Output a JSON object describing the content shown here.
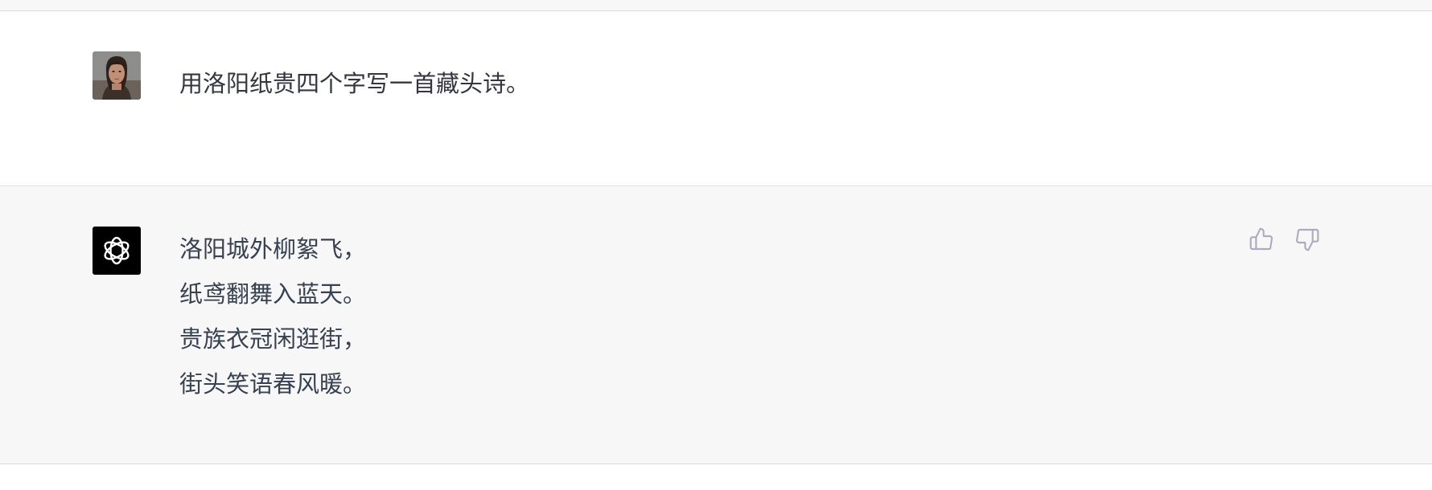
{
  "conversation": {
    "user_message": {
      "avatar_icon": "user-portrait-avatar",
      "text": "用洛阳纸贵四个字写一首藏头诗。"
    },
    "assistant_message": {
      "avatar_icon": "openai-logo-icon",
      "lines": [
        "洛阳城外柳絮飞，",
        "纸鸢翻舞入蓝天。",
        "贵族衣冠闲逛街，",
        "街头笑语春风暖。"
      ],
      "feedback": {
        "thumbs_up_icon": "thumbs-up-icon",
        "thumbs_down_icon": "thumbs-down-icon"
      }
    }
  },
  "colors": {
    "user_row_bg": "#ffffff",
    "assistant_row_bg": "#f7f7f8",
    "text": "#374151",
    "feedback_icon": "#acacbe"
  }
}
